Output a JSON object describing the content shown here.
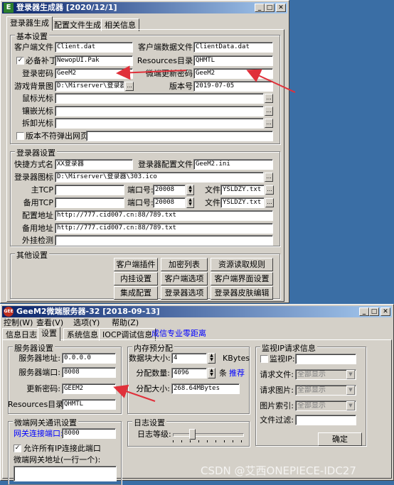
{
  "colors": {
    "desktop": "#3a6ea5",
    "title_start": "#0a246a",
    "title_end": "#a6caf0",
    "arrow": "#e0303a",
    "link": "#0000ff"
  },
  "w1": {
    "icon_letter": "E",
    "title": "登录器生成器 [2020/12/1]",
    "tabs": [
      "登录器生成",
      "配置文件生成",
      "相关信息"
    ],
    "basic": {
      "legend": "基本设置",
      "client_file_label": "客户端文件",
      "client_file": "Client.dat",
      "client_data_label": "客户端数据文件",
      "client_data": "ClientData.dat",
      "patch_label": "必备补丁",
      "patch": "NewopUI.Pak",
      "res_dir_label": "Resources目录",
      "res_dir": "QHMTL",
      "login_pwd_label": "登录密码",
      "login_pwd": "GeeM2",
      "micro_pwd_label": "微端更新密码",
      "micro_pwd": "GeeM2",
      "bg_label": "游戏背景图",
      "bg": "D:\\Mirserver\\登录器\\",
      "version_label": "版本号",
      "version": "2019-07-05",
      "mouse_label": "鼠标光标",
      "embed_label": "镶嵌光标",
      "dismantle_label": "拆卸光标",
      "nopopup_label": "版本不符弹出网页"
    },
    "login": {
      "legend": "登录器设置",
      "shortcut_label": "快捷方式名",
      "shortcut": "XX登录器",
      "cfg_label": "登录器配置文件",
      "cfg": "GeeM2.ini",
      "icon_label": "登录器图标",
      "icon": "D:\\Mirserver\\登录器\\303.ico",
      "main_tcp_label": "主TCP",
      "port_label": "端口号:",
      "main_port": "20008",
      "file_label": "文件",
      "main_file": "YSLDZY.txt",
      "backup_tcp_label": "备用TCP",
      "backup_port": "20008",
      "backup_file": "YSLDZY.txt",
      "cfg_addr_label": "配置地址",
      "cfg_addr": "http://777.cid007.cn:88/789.txt",
      "backup_addr_label": "备用地址",
      "backup_addr": "http://777.cid007.cn:88/789.txt",
      "plugin_check_label": "外挂检测"
    },
    "other": {
      "legend": "其他设置",
      "buttons": [
        "客户端插件",
        "加密列表",
        "资源读取规则",
        "内挂设置",
        "客户端选项",
        "客户端界面设置",
        "集成配置",
        "登录器选项",
        "登录器皮肤编辑"
      ]
    }
  },
  "w2": {
    "icon_label": "GEE",
    "title": "GeeM2微端服务器-32 [2018-09-13]",
    "menu": [
      "控制(W)",
      "查看(V)",
      "选项(Y)",
      "帮助(Z)"
    ],
    "tabs": [
      "信息日志",
      "设置",
      "系统信息",
      "IOCP调试信息"
    ],
    "promo": "成信专业零距离",
    "server": {
      "legend": "服务器设置",
      "addr_label": "服务器地址:",
      "addr": "0.0.0.0",
      "port_label": "服务器端口:",
      "port": "8008",
      "pwd_label": "更新密码:",
      "pwd": "GEEM2",
      "res_label": "Resources目录:",
      "res": "QHMTL"
    },
    "mem": {
      "legend": "内存预分配",
      "block_label": "数据块大小:",
      "block": "4",
      "block_unit": "KBytes",
      "count_label": "分配数量:",
      "count": "4096",
      "count_unit": "条",
      "count_link": "推荐",
      "size_label": "分配大小:",
      "size": "268.64MBytes"
    },
    "monitor": {
      "legend": "监视IP请求信息",
      "monitor_label": "监视IP:",
      "req_file_label": "请求文件:",
      "req_file": "全部显示",
      "req_img_label": "请求图片:",
      "req_img": "全部显示",
      "img_idx_label": "图片索引:",
      "img_idx": "全部显示",
      "filter_label": "文件过滤:",
      "ok": "确定"
    },
    "gateway": {
      "legend": "微端网关通讯设置",
      "port_label": "网关连接端口:",
      "port": "8000",
      "allow_label": "允许所有IP连接此端口",
      "addr_label": "微端网关地址(一行一个):"
    },
    "log": {
      "legend": "日志设置",
      "level_label": "日志等级:",
      "level": 0.25
    }
  },
  "watermark": "CSDN @艾西ONEPIECE-IDC27"
}
